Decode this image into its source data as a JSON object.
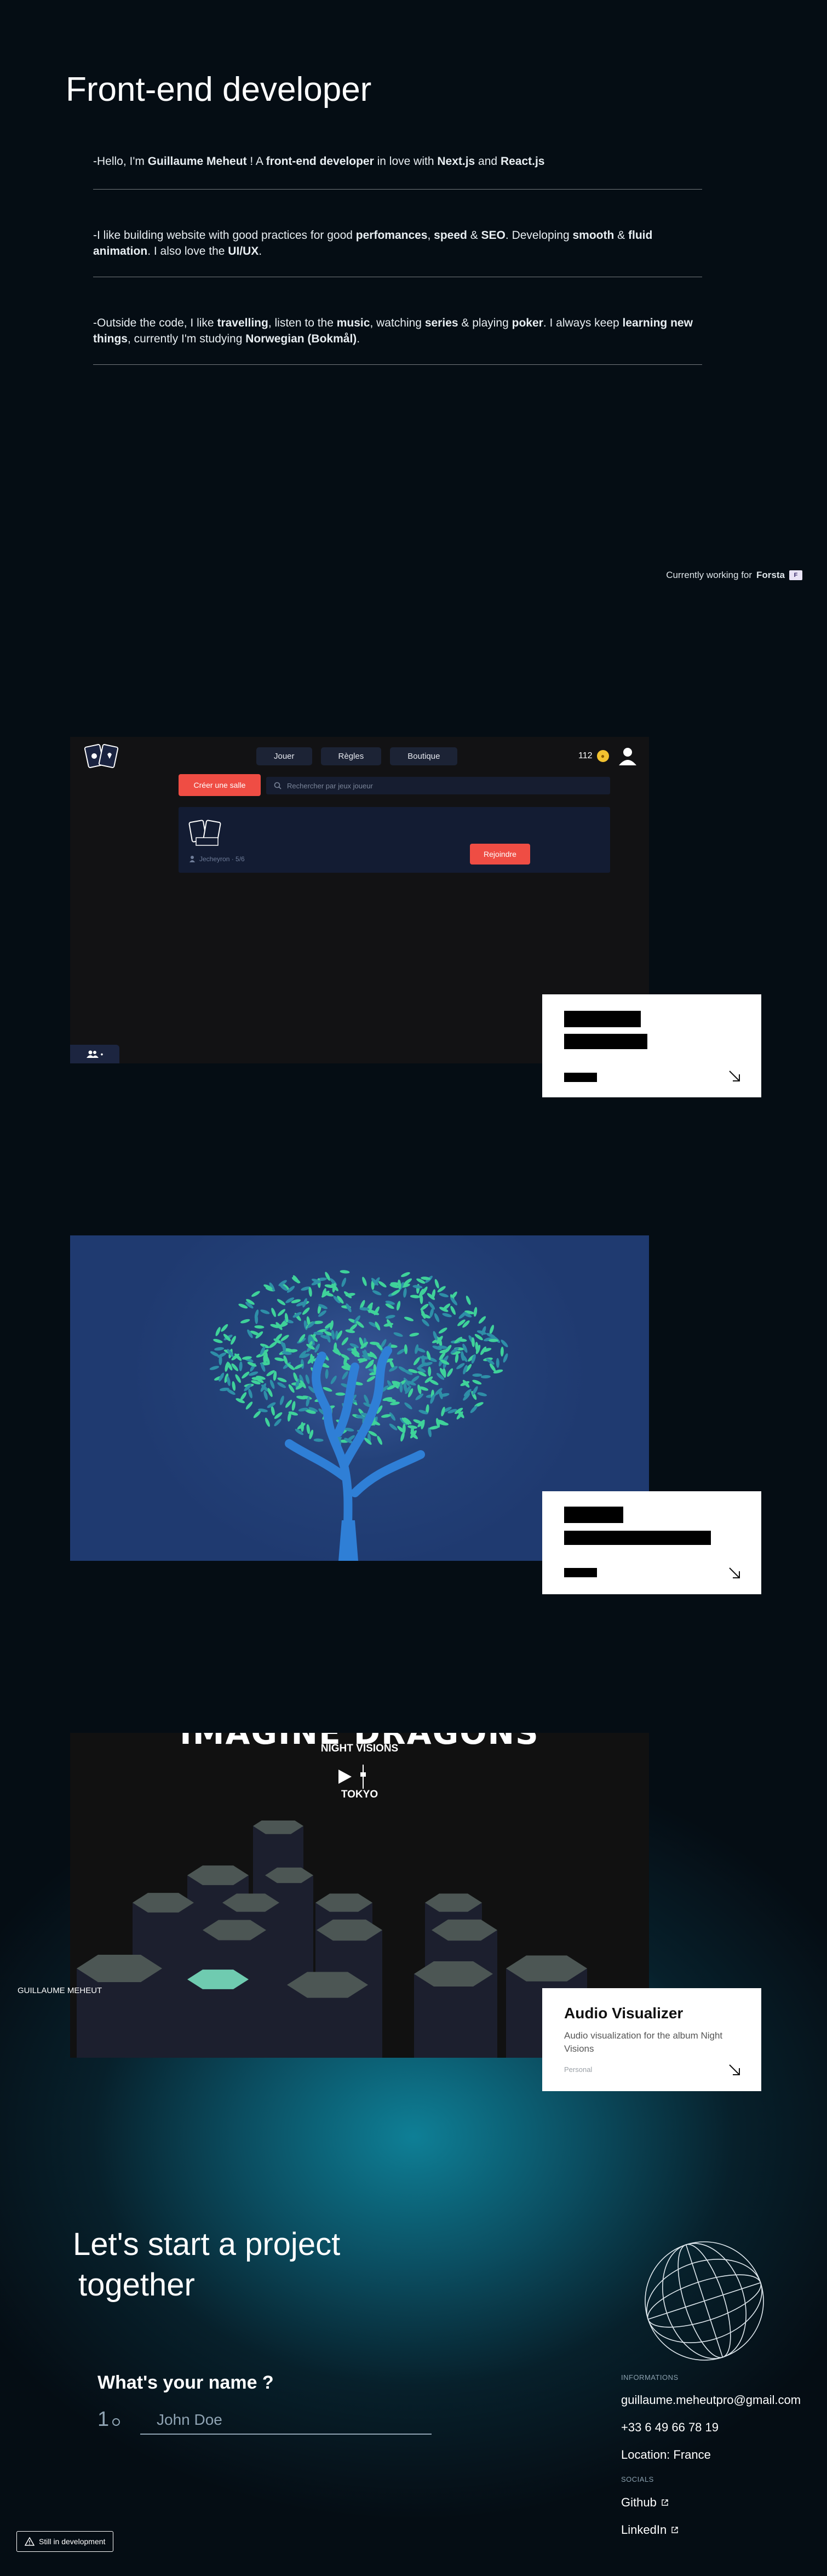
{
  "intro": {
    "title": "Front-end developer",
    "line1": [
      {
        "t": "-Hello, I'm ",
        "b": false
      },
      {
        "t": "Guillaume Meheut",
        "b": true
      },
      {
        "t": " ! A ",
        "b": false
      },
      {
        "t": "front-end developer",
        "b": true
      },
      {
        "t": " in love with ",
        "b": false
      },
      {
        "t": "Next.js",
        "b": true
      },
      {
        "t": " and ",
        "b": false
      },
      {
        "t": "React.js",
        "b": true
      }
    ],
    "line2": [
      {
        "t": "-I like building website with good practices for good ",
        "b": false
      },
      {
        "t": "perfomances",
        "b": true
      },
      {
        "t": ", ",
        "b": false
      },
      {
        "t": "speed",
        "b": true
      },
      {
        "t": " & ",
        "b": false
      },
      {
        "t": "SEO",
        "b": true
      },
      {
        "t": ". Developing ",
        "b": false
      },
      {
        "t": "smooth",
        "b": true
      },
      {
        "t": " & ",
        "b": false
      },
      {
        "t": "fluid animation",
        "b": true
      },
      {
        "t": ". I also love the ",
        "b": false
      },
      {
        "t": "UI/UX",
        "b": true
      },
      {
        "t": ".",
        "b": false
      }
    ],
    "line3": [
      {
        "t": "-Outside the code, I like ",
        "b": false
      },
      {
        "t": "travelling",
        "b": true
      },
      {
        "t": ", listen to the ",
        "b": false
      },
      {
        "t": "music",
        "b": true
      },
      {
        "t": ", watching ",
        "b": false
      },
      {
        "t": "series",
        "b": true
      },
      {
        "t": " & playing ",
        "b": false
      },
      {
        "t": "poker",
        "b": true
      },
      {
        "t": ". I always keep ",
        "b": false
      },
      {
        "t": "learning new things",
        "b": true
      },
      {
        "t": ", currently I'm studying ",
        "b": false
      },
      {
        "t": "Norwegian (Bokmål)",
        "b": true
      },
      {
        "t": ".",
        "b": false
      }
    ],
    "work_prefix": "Currently working for",
    "work_company": "Forsta",
    "work_logo": "F"
  },
  "poker_app": {
    "nav": [
      "Jouer",
      "Règles",
      "Boutique"
    ],
    "coins": "112",
    "create_room": "Créer une salle",
    "search_placeholder": "Rechercher par jeux joueur",
    "room_meta": "Jecheyron · 5/6",
    "join": "Rejoindre",
    "lobby_count": "•"
  },
  "projects": [
    {
      "title": "",
      "description": "",
      "tag": "",
      "redacted": true
    },
    {
      "title": "",
      "description": "",
      "tag": "",
      "redacted": true
    },
    {
      "title": "Audio Visualizer",
      "description": "Audio visualization for the album Night Visions",
      "tag": "Personal",
      "redacted": false
    }
  ],
  "visualizer": {
    "band": "IMAGINE DRAGONS",
    "album": "NIGHT VISIONS",
    "track": "TOKYO",
    "side_name": "GUILLAUME MEHEUT"
  },
  "contact": {
    "title_line1": "Let's start a project",
    "title_line2": "together",
    "question": "What's your name ?",
    "question_number": "1",
    "name_placeholder": "John Doe",
    "info_heading": "INFORMATIONS",
    "email": "guillaume.meheutpro@gmail.com",
    "phone": "+33 6 49 66 78 19",
    "location": "Location: France",
    "socials_heading": "SOCIALS",
    "github": "Github",
    "linkedin": "LinkedIn"
  },
  "dev_badge": "Still in development",
  "colors": {
    "accent_red": "#ef4d44",
    "leaf_green": "#3fd29a",
    "trunk_blue": "#2f7fd6",
    "teal_hex": "#6fcbb0"
  }
}
